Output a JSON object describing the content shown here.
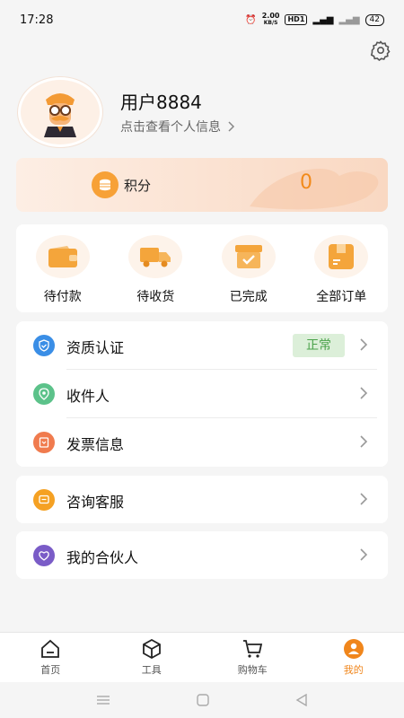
{
  "status_bar": {
    "time": "17:28",
    "net_speed": "2.00",
    "net_unit": "KB/S",
    "hd": "HD1",
    "battery": "42"
  },
  "profile": {
    "username": "用户8884",
    "link_text": "点击查看个人信息"
  },
  "points": {
    "label": "积分",
    "value": "0"
  },
  "orders": [
    {
      "label": "待付款",
      "icon": "wallet-icon"
    },
    {
      "label": "待收货",
      "icon": "truck-icon"
    },
    {
      "label": "已完成",
      "icon": "box-check-icon"
    },
    {
      "label": "全部订单",
      "icon": "order-list-icon"
    }
  ],
  "menu_group1": [
    {
      "label": "资质认证",
      "icon": "shield-check-icon",
      "badge": "正常",
      "color": "#3a8ee6"
    },
    {
      "label": "收件人",
      "icon": "location-pin-icon",
      "color": "#5cc28a"
    },
    {
      "label": "发票信息",
      "icon": "invoice-icon",
      "color": "#f07b4e"
    }
  ],
  "menu_group2": [
    {
      "label": "咨询客服",
      "icon": "chat-icon",
      "color": "#f5a123"
    }
  ],
  "menu_group3": [
    {
      "label": "我的合伙人",
      "icon": "partner-heart-icon",
      "color": "#7a5cc7"
    }
  ],
  "tabs": [
    {
      "label": "首页",
      "icon": "home-icon"
    },
    {
      "label": "工具",
      "icon": "cube-icon"
    },
    {
      "label": "购物车",
      "icon": "cart-icon"
    },
    {
      "label": "我的",
      "icon": "user-icon",
      "active": true
    }
  ],
  "accent_color": "#f0861c"
}
